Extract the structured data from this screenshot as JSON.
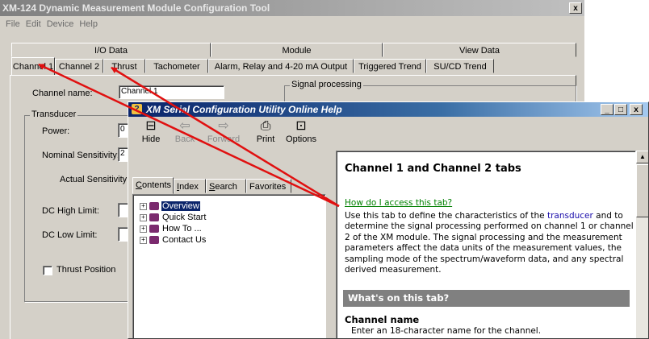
{
  "config_window": {
    "title": "XM-124 Dynamic Measurement Module Configuration Tool",
    "close_glyph": "x",
    "menu": [
      "File",
      "Edit",
      "Device",
      "Help"
    ],
    "tab_groups": [
      "I/O Data",
      "Module",
      "View Data"
    ],
    "tabs": [
      "Channel 1",
      "Channel 2",
      "Thrust",
      "Tachometer",
      "Alarm, Relay and 4-20 mA Output",
      "Triggered Trend",
      "SU/CD Trend"
    ],
    "selected_tab": "Channel 1",
    "channel_name_label": "Channel name:",
    "channel_name_value": "Channel 1",
    "signal_processing_label": "Signal processing",
    "transducer_group_label": "Transducer",
    "power_label": "Power:",
    "power_value": "0",
    "nominal_sensitivity_label": "Nominal Sensitivity:",
    "nominal_sensitivity_value": "2",
    "actual_sensitivity_label": "Actual Sensitivity",
    "dc_high_limit_label": "DC High Limit:",
    "dc_low_limit_label": "DC Low Limit:",
    "thrust_position_label": "Thrust Position"
  },
  "help_window": {
    "title": "XM Serial Configuration Utility Online Help",
    "toolbar": [
      {
        "label": "Hide",
        "icon": "hide-icon",
        "glyph": "⊟",
        "enabled": true
      },
      {
        "label": "Back",
        "icon": "back-arrow-icon",
        "glyph": "⇦",
        "enabled": false
      },
      {
        "label": "Forward",
        "icon": "forward-arrow-icon",
        "glyph": "⇨",
        "enabled": false
      },
      {
        "label": "Print",
        "icon": "printer-icon",
        "glyph": "⎙",
        "enabled": true
      },
      {
        "label": "Options",
        "icon": "options-icon",
        "glyph": "⊡",
        "enabled": true
      }
    ],
    "nav_tabs": [
      {
        "first": "C",
        "rest": "ontents"
      },
      {
        "first": "I",
        "rest": "ndex"
      },
      {
        "first": "S",
        "rest": "earch"
      },
      {
        "first": "",
        "rest": "Favorites"
      }
    ],
    "tree": [
      "Overview",
      "Quick Start",
      "How To ...",
      "Contact Us"
    ],
    "selected_tree_item": "Overview",
    "content": {
      "heading": "Channel 1 and Channel 2 tabs",
      "access_link": "How do I access this tab?",
      "para_start": "Use this tab to define the characteristics of the ",
      "para_link": "transducer",
      "para_end": " and to determine the signal processing performed on channel 1 or channel 2 of the XM module. The signal processing and the measurement parameters affect the data units of the measurement values, the sampling mode of the spectrum/waveform data, and any spectral derived measurement.",
      "section_bar": "What's on this tab?",
      "subheading": "Channel name",
      "subtext": "Enter an 18-character name for the channel."
    }
  },
  "annotation_color": "#e01010"
}
